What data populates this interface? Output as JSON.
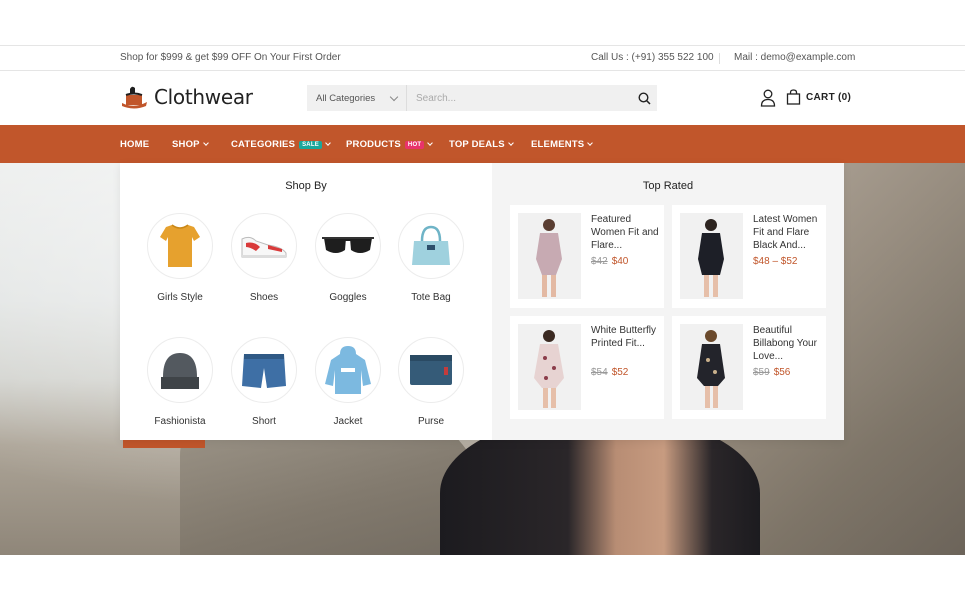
{
  "topbar": {
    "promo": "Shop for $999 & get $99 OFF On Your First Order",
    "call": "Call Us : (+91) 355 522 100",
    "mail": "Mail : demo@example.com"
  },
  "header": {
    "logo_text": "Clothwear",
    "category_select": "All Categories",
    "search_placeholder": "Search...",
    "cart_label": "CART (0)"
  },
  "nav": {
    "items": [
      {
        "label": "HOME"
      },
      {
        "label": "SHOP"
      },
      {
        "label": "CATEGORIES",
        "badge": "SALE"
      },
      {
        "label": "PRODUCTS",
        "badge": "HOT"
      },
      {
        "label": "TOP DEALS"
      },
      {
        "label": "ELEMENTS"
      }
    ]
  },
  "mega_menu": {
    "shop_by_title": "Shop By",
    "categories": [
      {
        "label": "Girls Style",
        "icon": "tshirt-icon"
      },
      {
        "label": "Shoes",
        "icon": "sneaker-icon"
      },
      {
        "label": "Goggles",
        "icon": "sunglasses-icon"
      },
      {
        "label": "Tote Bag",
        "icon": "handbag-icon"
      },
      {
        "label": "Fashionista",
        "icon": "beanie-icon"
      },
      {
        "label": "Short",
        "icon": "shorts-icon"
      },
      {
        "label": "Jacket",
        "icon": "hoodie-icon"
      },
      {
        "label": "Purse",
        "icon": "wallet-icon"
      }
    ],
    "top_rated_title": "Top Rated",
    "products": [
      {
        "name": "Featured Women Fit and Flare...",
        "old_price": "$42",
        "price": "$40"
      },
      {
        "name": "Latest Women Fit and Flare Black And...",
        "old_price": "",
        "price": "$48 – $52"
      },
      {
        "name": "White Butterfly Printed Fit...",
        "old_price": "$54",
        "price": "$52"
      },
      {
        "name": "Beautiful Billabong Your Love...",
        "old_price": "$59",
        "price": "$56"
      }
    ]
  },
  "colors": {
    "accent": "#c1562b",
    "sale_badge": "#1aa79b",
    "hot_badge": "#e8336b"
  }
}
